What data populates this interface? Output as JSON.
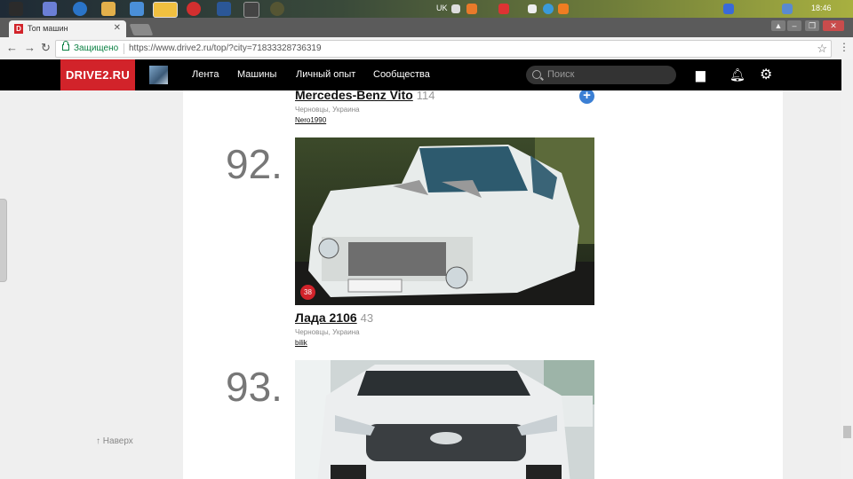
{
  "taskbar": {
    "tray_lang": "UK",
    "tray_time": "18:46"
  },
  "browser": {
    "tab_title": "Топ машин",
    "tab_favicon": "D",
    "secure_label": "Защищено",
    "url": "https://www.drive2.ru/top/?city=71833328736319"
  },
  "site": {
    "logo": "DRIVE2.RU",
    "nav": [
      "Лента",
      "Машины",
      "Личный опыт",
      "Сообщества"
    ],
    "search_placeholder": "Поиск",
    "top_link": "Наверх"
  },
  "cars": [
    {
      "name": "Mercedes-Benz Vito",
      "count": "114",
      "city": "Черновцы, Украина",
      "owner": "Nero1990"
    },
    {
      "rank": "92.",
      "name": "Лада 2106",
      "count": "43",
      "city": "Черновцы, Украина",
      "owner": "bilik",
      "badge": "38"
    },
    {
      "rank": "93."
    }
  ],
  "colors": {
    "brand_red": "#d2232a",
    "header_black": "#000000",
    "add_blue": "#3b7fd4"
  }
}
